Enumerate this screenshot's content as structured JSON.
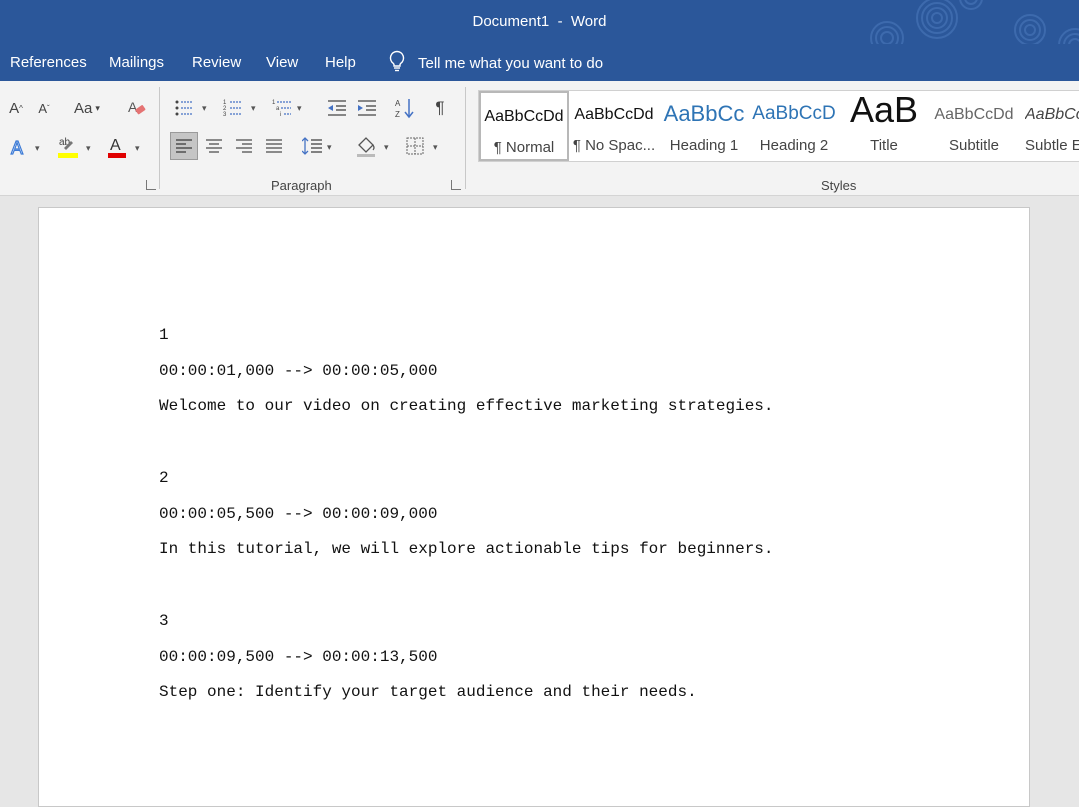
{
  "window": {
    "doc_name": "Document1",
    "separator": "-",
    "app_name": "Word"
  },
  "menu_tabs": [
    "References",
    "Mailings",
    "Review",
    "View",
    "Help"
  ],
  "tell_me": {
    "text": "Tell me what you want to do"
  },
  "ribbon": {
    "groups": {
      "paragraph": "Paragraph",
      "styles": "Styles"
    },
    "font_colors": {
      "highlight": "#ffff00",
      "font": "#e00000"
    },
    "styles": [
      {
        "sample": "AaBbCcDd",
        "name": "¶ Normal"
      },
      {
        "sample": "AaBbCcDd",
        "name": "¶ No Spac..."
      },
      {
        "sample": "AaBbCc",
        "name": "Heading 1"
      },
      {
        "sample": "AaBbCcD",
        "name": "Heading 2"
      },
      {
        "sample": "AaB",
        "name": "Title"
      },
      {
        "sample": "AaBbCcDd",
        "name": "Subtitle"
      },
      {
        "sample": "AaBbCcD",
        "name": "Subtle E"
      }
    ]
  },
  "document": {
    "lines": [
      "1",
      "00:00:01,000 --> 00:00:05,000",
      "Welcome to our video on creating effective marketing strategies.",
      "2",
      "00:00:05,500 --> 00:00:09,000",
      "In this tutorial, we will explore actionable tips for beginners.",
      "3",
      "00:00:09,500 --> 00:00:13,500",
      "Step one: Identify your target audience and their needs."
    ]
  },
  "colors": {
    "brand": "#2b579a",
    "ribbon_bg": "#f3f3f3",
    "canvas_bg": "#e6e6e6"
  }
}
